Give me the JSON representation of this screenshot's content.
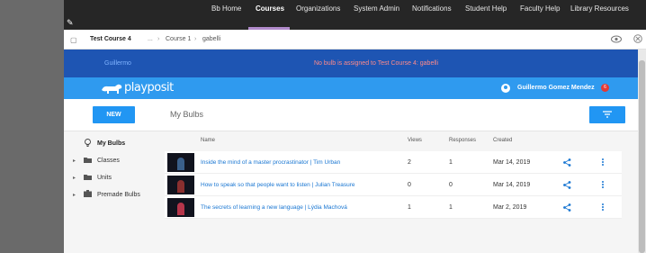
{
  "topnav": {
    "items": [
      "Bb Home",
      "Courses",
      "Organizations",
      "System Admin",
      "Notifications",
      "Student Help",
      "Faculty Help",
      "Library Resources"
    ],
    "active": "Courses"
  },
  "crumbbar": {
    "course": "Test Course 4",
    "ellipsis": "...",
    "crumb1": "Course 1",
    "crumb2": "gabelli"
  },
  "banner": {
    "user": "Guillermo",
    "message": "No bulb is assigned to Test Course 4: gabelli"
  },
  "header": {
    "logo": "playposit",
    "account_name": "Guillermo Gomez Mendez",
    "badge": "6",
    "accent": "#2f9aef"
  },
  "toolbar": {
    "new_label": "NEW",
    "title": "My Bulbs"
  },
  "sidebar": {
    "items": [
      {
        "label": "My Bulbs",
        "icon": "bulb-icon"
      },
      {
        "label": "Classes",
        "icon": "class-folder-icon"
      },
      {
        "label": "Units",
        "icon": "folder-icon"
      },
      {
        "label": "Premade Bulbs",
        "icon": "premade-icon"
      }
    ]
  },
  "table": {
    "headers": {
      "name": "Name",
      "views": "Views",
      "responses": "Responses",
      "created": "Created"
    },
    "rows": [
      {
        "title": "Inside the mind of a master procrastinator | Tim Urban",
        "views": "2",
        "responses": "1",
        "created": "Mar 14, 2019"
      },
      {
        "title": "How to speak so that people want to listen | Julian Treasure",
        "views": "0",
        "responses": "0",
        "created": "Mar 14, 2019"
      },
      {
        "title": "The secrets of learning a new language | Lýdia Machová",
        "views": "1",
        "responses": "1",
        "created": "Mar 2, 2019"
      }
    ]
  }
}
